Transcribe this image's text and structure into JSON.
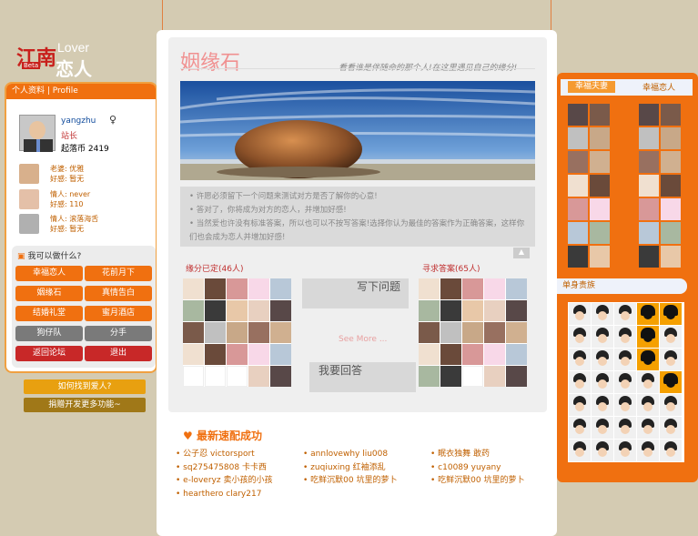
{
  "logo": {
    "jz": "江南",
    "beta": "Beta",
    "lover": "Lover",
    "lianren": "恋人"
  },
  "profile": {
    "header": "个人资料 | Profile",
    "username": "yangzhu",
    "role": "站长",
    "coins": "起落币 2419",
    "relations": [
      {
        "l1": "老婆:  优雅",
        "l2": "好感:  暂无",
        "color": "#d8b08c"
      },
      {
        "l1": "情人:  never",
        "l2": "好感:  110",
        "color": "#e4c0a8"
      },
      {
        "l1": "情人:  滚落海舌",
        "l2": "好感:  暂无",
        "color": "#b0b0b0"
      }
    ]
  },
  "actions": {
    "title": "我可以做什么?",
    "buttons": [
      {
        "label": "幸福恋人",
        "style": "b-or"
      },
      {
        "label": "花前月下",
        "style": "b-or"
      },
      {
        "label": "姻缘石",
        "style": "b-or"
      },
      {
        "label": "真情告白",
        "style": "b-or"
      },
      {
        "label": "结婚礼堂",
        "style": "b-or"
      },
      {
        "label": "蜜月酒店",
        "style": "b-or"
      },
      {
        "label": "狗仔队",
        "style": "b-gr"
      },
      {
        "label": "分手",
        "style": "b-gr"
      },
      {
        "label": "返回论坛",
        "style": "b-rd"
      },
      {
        "label": "退出",
        "style": "b-rd"
      }
    ],
    "find_love": "如何找到爱人?",
    "donate": "捐赠开发更多功能~"
  },
  "stone": {
    "title": "姻缘石",
    "subtitle": "看看谁是伴随命的那个人!在这里遇见自己的缘分!",
    "tips": [
      "• 许愿必须留下一个问题来测试对方是否了解你的心意!",
      "• 答对了，你将成为对方的恋人，并增加好感!",
      "• 当然爱也许没有标准答案，所以也可以不按写答案!选择你认为最佳的答案作为正确答案，这样你们也会成为恋人并增加好感!"
    ],
    "up": "▲",
    "answered_label": "缘分已定(46人)",
    "seeking_label": "寻求答案(65人)",
    "write_q": "写下问题",
    "see_more": "See More ...",
    "my_answer": "我要回答"
  },
  "latest": {
    "title": "最新速配成功",
    "col1": [
      "公子忍 victorsport",
      "sq275475808 卡卡西",
      "e-loveryz 卖小孩的小孩",
      "hearthero clary217"
    ],
    "col2": [
      "annlovewhy liu008",
      "zuqiuxing 红袖添乱",
      "吃鲜沉默00 坑里的萝卜"
    ],
    "col3": [
      "眠衣独舞 敢药",
      "c10089 yuyany",
      "吃鲜沉默00 坑里的萝卜"
    ]
  },
  "right": {
    "tab_couple": "幸福夫妻",
    "tab_lovers": "幸福恋人",
    "single": "单身贵族"
  }
}
